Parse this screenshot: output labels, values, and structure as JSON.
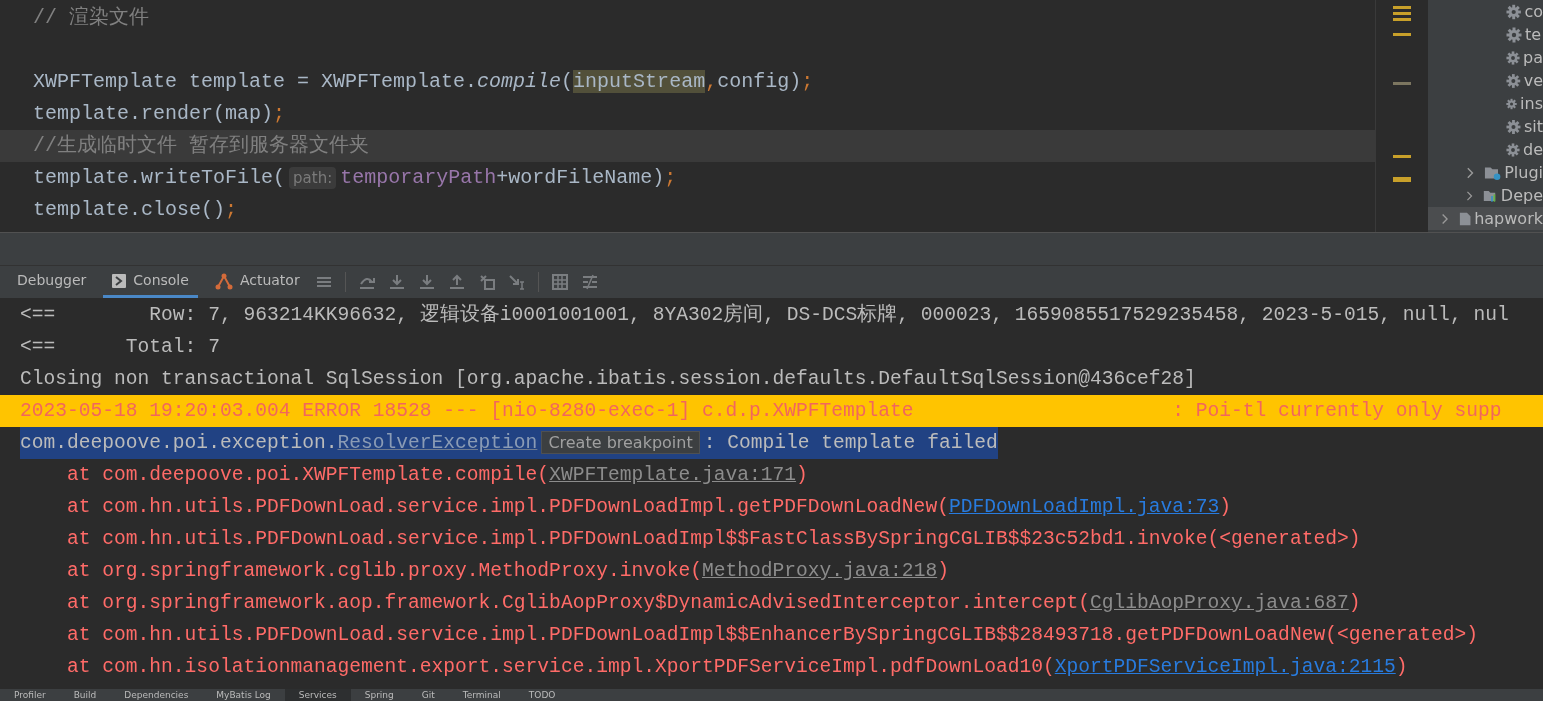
{
  "editor": {
    "lines": [
      {
        "current": false,
        "tokens": [
          {
            "kind": "comment",
            "text": "// 渲染文件"
          }
        ]
      },
      {
        "current": false
      },
      {
        "current": false,
        "tokens": [
          {
            "kind": "plain",
            "text": "XWPFTemplate template = XWPFTemplate."
          },
          {
            "kind": "italic",
            "text": "compile"
          },
          {
            "kind": "plain",
            "text": "("
          },
          {
            "kind": "highlight",
            "text": "inputStream"
          },
          {
            "kind": "punct",
            "text": ","
          },
          {
            "kind": "plain",
            "text": "config)"
          },
          {
            "kind": "punct",
            "text": ";"
          }
        ]
      },
      {
        "current": false,
        "tokens": [
          {
            "kind": "plain",
            "text": "template.render(map)"
          },
          {
            "kind": "punct",
            "text": ";"
          }
        ]
      },
      {
        "current": true,
        "tokens": [
          {
            "kind": "comment",
            "text": "//生成临时文件 暂存到服务器文件夹"
          }
        ]
      },
      {
        "current": false,
        "tokens": [
          {
            "kind": "plain",
            "text": "template.writeToFile("
          },
          {
            "kind": "hint",
            "text": "path:"
          },
          {
            "kind": "field",
            "text": "temporaryPath"
          },
          {
            "kind": "plain",
            "text": "+wordFileName)"
          },
          {
            "kind": "punct",
            "text": ";"
          }
        ]
      },
      {
        "current": false,
        "tokens": [
          {
            "kind": "plain",
            "text": "template.close()"
          },
          {
            "kind": "punct",
            "text": ";"
          }
        ]
      }
    ]
  },
  "project_tree": {
    "items": [
      {
        "kind": "file",
        "label": "co"
      },
      {
        "kind": "file",
        "label": "te"
      },
      {
        "kind": "file",
        "label": "pa"
      },
      {
        "kind": "file",
        "label": "ve"
      },
      {
        "kind": "file",
        "label": "ins"
      },
      {
        "kind": "file",
        "label": "sit"
      },
      {
        "kind": "file",
        "label": "de"
      },
      {
        "kind": "folder",
        "label": "Plugi",
        "expanded": false
      },
      {
        "kind": "folder",
        "label": "Depe",
        "expanded": false
      },
      {
        "kind": "module",
        "label": "hapwork",
        "expanded": false
      }
    ]
  },
  "debug_tabs": [
    {
      "label": "Debugger",
      "selected": false
    },
    {
      "label": "Console",
      "selected": true
    },
    {
      "label": "Actuator",
      "selected": false
    }
  ],
  "console": {
    "lines": [
      {
        "kind": "plain",
        "tokens": [
          {
            "kind": "text",
            "text": "<==        Row: 7, 963214KK96632, 逻辑设备i0001001001, 8YA302房间, DS-DCS标牌, 000023, 1659085517529235458, 2023-5-015, null, nul"
          }
        ]
      },
      {
        "kind": "plain",
        "tokens": [
          {
            "kind": "text",
            "text": "<==      Total: 7"
          }
        ]
      },
      {
        "kind": "plain",
        "tokens": [
          {
            "kind": "text",
            "text": "Closing non transactional SqlSession [org.apache.ibatis.session.defaults.DefaultSqlSession@436cef28]"
          }
        ]
      },
      {
        "kind": "error_header",
        "tokens": [
          {
            "kind": "text",
            "text": "2023-05-18 19:20:03.004 ERROR 18528 --- [nio-8280-exec-1] c.d.p.XWPFTemplate                      : Poi-tl currently only supp"
          }
        ]
      },
      {
        "kind": "exception",
        "tokens": [
          {
            "kind": "text",
            "text": "com.deepoove.poi.exception."
          },
          {
            "kind": "class_link",
            "text": "ResolverException"
          },
          {
            "kind": "tooltip",
            "text": "Create breakpoint"
          },
          {
            "kind": "text",
            "text": ": Compile template failed"
          }
        ]
      },
      {
        "kind": "stack",
        "tokens": [
          {
            "kind": "text",
            "text": "    at com.deepoove.poi.XWPFTemplate.compile("
          },
          {
            "kind": "library_link",
            "text": "XWPFTemplate.java:171"
          },
          {
            "kind": "text",
            "text": ")"
          }
        ]
      },
      {
        "kind": "stack",
        "tokens": [
          {
            "kind": "text",
            "text": "    at com.hn.utils.PDFDownLoad.service.impl.PDFDownLoadImpl.getPDFDownLoadNew("
          },
          {
            "kind": "source_link",
            "text": "PDFDownLoadImpl.java:73"
          },
          {
            "kind": "text",
            "text": ")"
          }
        ]
      },
      {
        "kind": "stack",
        "tokens": [
          {
            "kind": "text",
            "text": "    at com.hn.utils.PDFDownLoad.service.impl.PDFDownLoadImpl$$FastClassBySpringCGLIB$$23c52bd1.invoke(<generated>)"
          }
        ]
      },
      {
        "kind": "stack",
        "tokens": [
          {
            "kind": "text",
            "text": "    at org.springframework.cglib.proxy.MethodProxy.invoke("
          },
          {
            "kind": "library_link",
            "text": "MethodProxy.java:218"
          },
          {
            "kind": "text",
            "text": ")"
          }
        ]
      },
      {
        "kind": "stack",
        "tokens": [
          {
            "kind": "text",
            "text": "    at org.springframework.aop.framework.CglibAopProxy$DynamicAdvisedInterceptor.intercept("
          },
          {
            "kind": "library_link",
            "text": "CglibAopProxy.java:687"
          },
          {
            "kind": "text",
            "text": ")"
          }
        ]
      },
      {
        "kind": "stack",
        "tokens": [
          {
            "kind": "text",
            "text": "    at com.hn.utils.PDFDownLoad.service.impl.PDFDownLoadImpl$$EnhancerBySpringCGLIB$$28493718.getPDFDownLoadNew(<generated>)"
          }
        ]
      },
      {
        "kind": "stack",
        "tokens": [
          {
            "kind": "text",
            "text": "    at com.hn.isolationmanagement.export.service.impl.XportPDFServiceImpl.pdfDownLoad10("
          },
          {
            "kind": "source_link",
            "text": "XportPDFServiceImpl.java:2115"
          },
          {
            "kind": "text",
            "text": ")"
          }
        ]
      }
    ]
  },
  "bottom_tabs": [
    {
      "label": "Profiler",
      "selected": false
    },
    {
      "label": "Build",
      "selected": false
    },
    {
      "label": "Dependencies",
      "selected": false
    },
    {
      "label": "MyBatis Log",
      "selected": false
    },
    {
      "label": "Services",
      "selected": true
    },
    {
      "label": "Spring",
      "selected": false
    },
    {
      "label": "Git",
      "selected": false
    },
    {
      "label": "Terminal",
      "selected": false
    },
    {
      "label": "TODO",
      "selected": false
    }
  ]
}
